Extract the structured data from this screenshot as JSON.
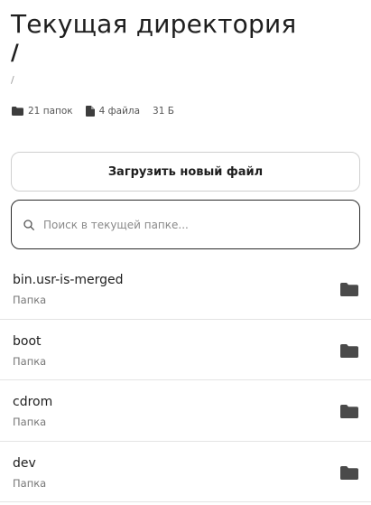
{
  "header": {
    "title": "Текущая директория",
    "path": "/",
    "breadcrumb": "/"
  },
  "stats": {
    "folders": "21 папок",
    "files": "4 файла",
    "size": "31 Б"
  },
  "upload_button": "Загрузить новый файл",
  "search": {
    "placeholder": "Поиск в текущей папке...",
    "value": ""
  },
  "items": [
    {
      "name": "bin.usr-is-merged",
      "type": "Папка",
      "icon": "folder-icon"
    },
    {
      "name": "boot",
      "type": "Папка",
      "icon": "folder-icon"
    },
    {
      "name": "cdrom",
      "type": "Папка",
      "icon": "folder-icon"
    },
    {
      "name": "dev",
      "type": "Папка",
      "icon": "folder-icon"
    }
  ],
  "colors": {
    "text": "#1e1e1e",
    "muted": "#777777",
    "icon": "#4a4a4a",
    "border": "#cfcfcf"
  }
}
